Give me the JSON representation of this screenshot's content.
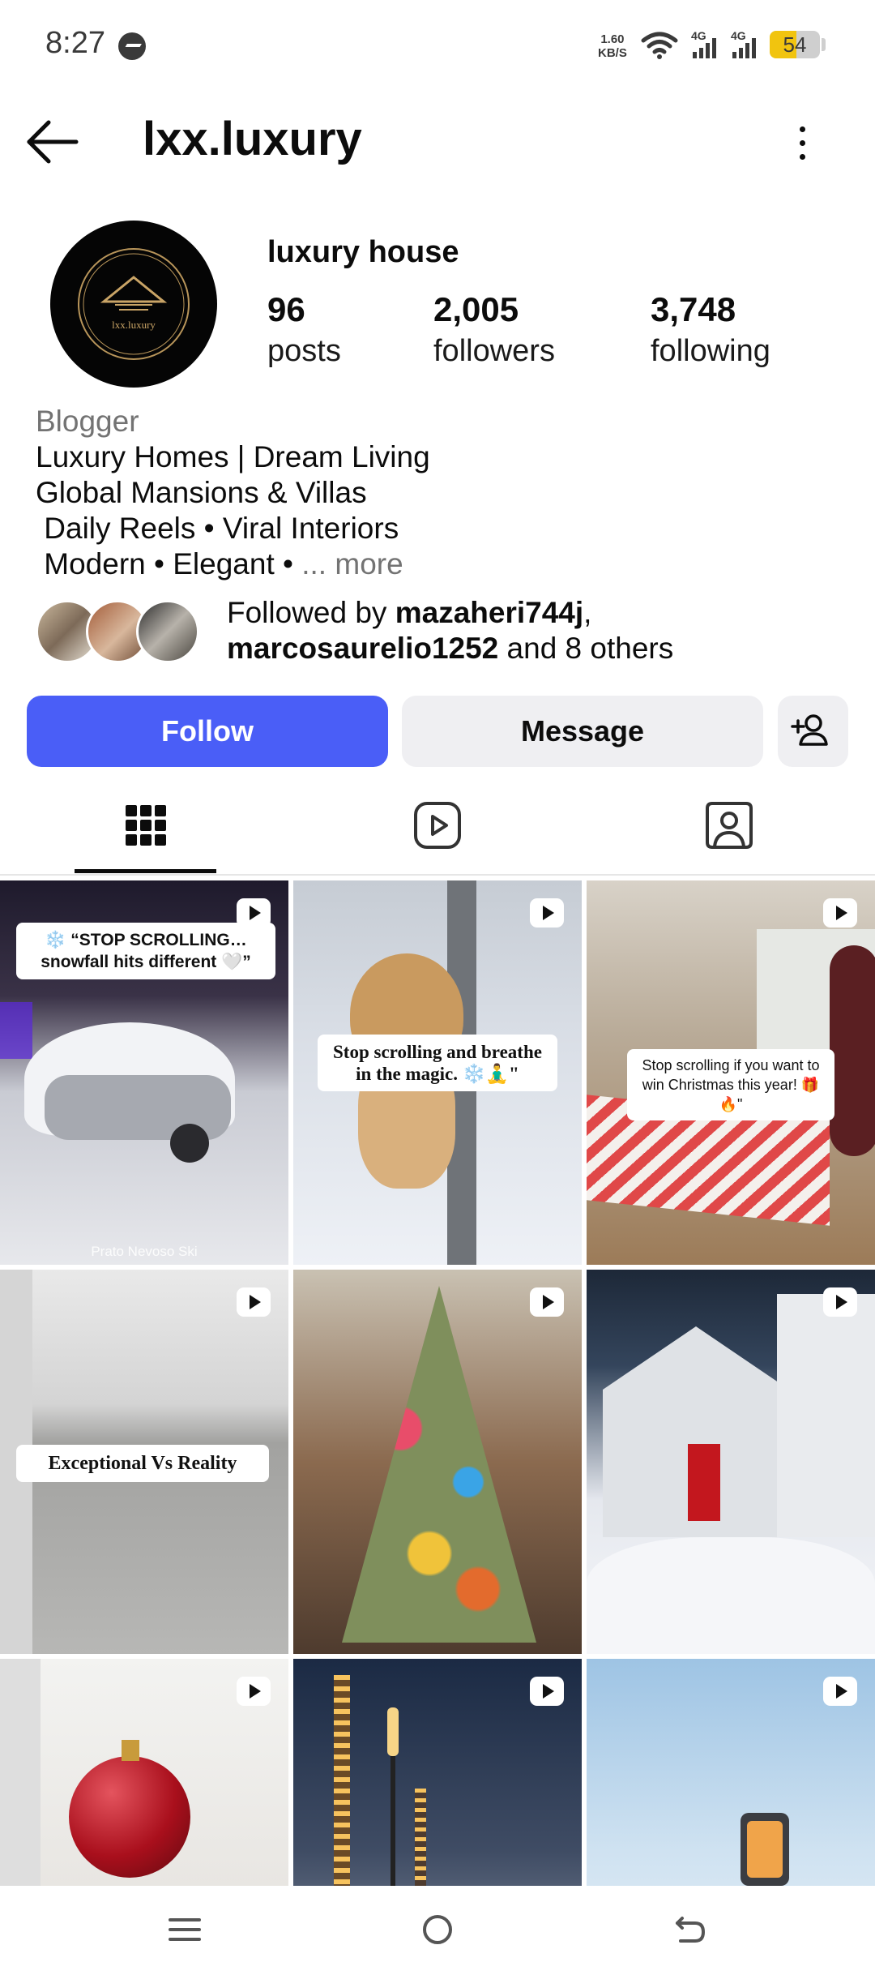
{
  "status_bar": {
    "time": "8:27",
    "net_speed_value": "1.60",
    "net_speed_unit": "KB/S",
    "signal1": "4G",
    "signal2": "4G",
    "battery_level": "54",
    "battery_fraction": 0.54
  },
  "header": {
    "username": "lxx.luxury"
  },
  "profile": {
    "display_name": "luxury house",
    "avatar_logo_text": "lxx.luxury",
    "stats": [
      {
        "number": "96",
        "label": "posts"
      },
      {
        "number": "2,005",
        "label": "followers"
      },
      {
        "number": "3,748",
        "label": "following"
      }
    ],
    "category": "Blogger",
    "bio_lines": [
      "Luxury Homes | Dream Living",
      "Global Mansions & Villas",
      " Daily Reels • Viral Interiors",
      " Modern • Elegant • "
    ],
    "bio_more": "... more",
    "followed_by": {
      "prefix": "Followed by ",
      "user1": "mazaheri744j",
      "separator": ",",
      "user2": "marcosaurelio1252",
      "suffix": " and 8 others"
    }
  },
  "actions": {
    "follow": "Follow",
    "message": "Message"
  },
  "tabs": [
    {
      "name": "posts-grid",
      "icon": "grid-icon"
    },
    {
      "name": "reels",
      "icon": "reels-icon"
    },
    {
      "name": "tagged",
      "icon": "tagged-icon"
    }
  ],
  "grid": {
    "posts": [
      {
        "caption": "❄️ “STOP SCROLLING… snowfall hits different 🤍”",
        "location": "Prato Nevoso Ski"
      },
      {
        "caption": "Stop scrolling and breathe in the magic. ❄️🧘‍♂️\""
      },
      {
        "caption": "Stop scrolling if you want to win Christmas this year! 🎁🔥\""
      },
      {
        "caption": "Exceptional Vs Reality"
      },
      {
        "caption": ""
      },
      {
        "caption": ""
      },
      {
        "caption": ""
      },
      {
        "caption": ""
      },
      {
        "caption": ""
      }
    ]
  },
  "colors": {
    "accent": "#4a5ef7",
    "secondary_button": "#efeff2",
    "muted_text": "#737373"
  }
}
